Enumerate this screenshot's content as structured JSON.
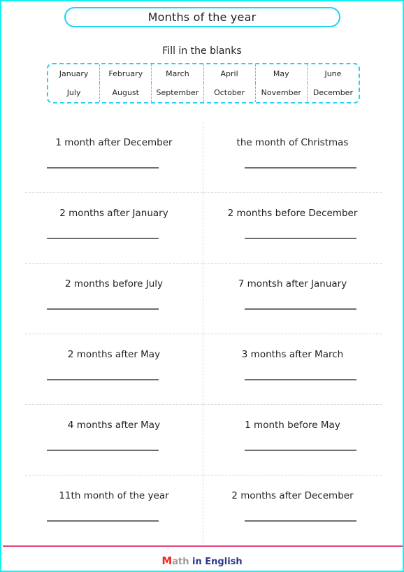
{
  "page": {
    "border_color": "#12efef",
    "background": "#ffffff"
  },
  "title": {
    "text": "Months of the year",
    "border_color": "#17d6f0"
  },
  "subtitle": {
    "text": "Fill in the blanks"
  },
  "months_box": {
    "border_color": "#22d3ee",
    "rows": [
      [
        "January",
        "February",
        "March",
        "April",
        "May",
        "June"
      ],
      [
        "July",
        "August",
        "September",
        "October",
        "November",
        "December"
      ]
    ]
  },
  "questions": {
    "rows": [
      {
        "left": "1 month after December",
        "right": "the month of Christmas"
      },
      {
        "left": "2 months after January",
        "right": "2 months before December"
      },
      {
        "left": "2 months before July",
        "right": "7 montsh after January"
      },
      {
        "left": "2 months after May",
        "right": "3 months after March"
      },
      {
        "left": "4 months after May",
        "right": "1 month before May"
      },
      {
        "left": "11th month of the year",
        "right": "2 months after December"
      }
    ]
  },
  "footer": {
    "rule_color": "#e0457b",
    "logo": {
      "initial": "M",
      "initial_color": "#f4241f",
      "second": "ath",
      "second_color": "#9a9a9a",
      "rest": " in English",
      "rest_color": "#2c3a8c"
    }
  }
}
